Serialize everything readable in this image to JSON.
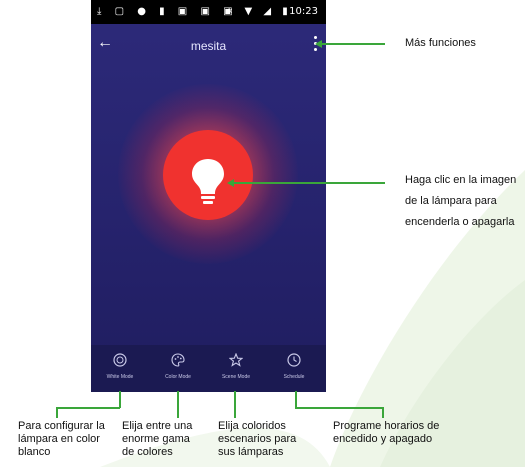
{
  "status_bar": {
    "left_icons": "⤓ ▢ ● ▮ ▣ ▣ ▣",
    "right_icons": "∗ ▼ ◢ ▮",
    "time": "10:23"
  },
  "app": {
    "title": "mesita"
  },
  "modes": [
    {
      "label": "White Mode",
      "icon": "circle-icon"
    },
    {
      "label": "Color Mode",
      "icon": "palette-icon"
    },
    {
      "label": "Scene Mode",
      "icon": "star-icon"
    },
    {
      "label": "Schedule",
      "icon": "clock-icon"
    }
  ],
  "annotations": {
    "more_functions": "Más funciones",
    "lamp_tap": [
      "Haga clic en la imagen",
      "de la lámpara para",
      "encenderla o apagarla"
    ],
    "white_mode": [
      "Para configurar la",
      "lámpara en color",
      "blanco"
    ],
    "color_mode": [
      "Elija entre una",
      "enorme gama",
      "de colores"
    ],
    "scene_mode": [
      "Elija coloridos",
      "escenarios para",
      "sus lámparas"
    ],
    "schedule": [
      "Programe horarios de",
      "encedido y apagado"
    ]
  },
  "colors": {
    "accent_line": "#3aa63a",
    "lamp": "#f0322f",
    "phone_bg": "#26246e"
  }
}
